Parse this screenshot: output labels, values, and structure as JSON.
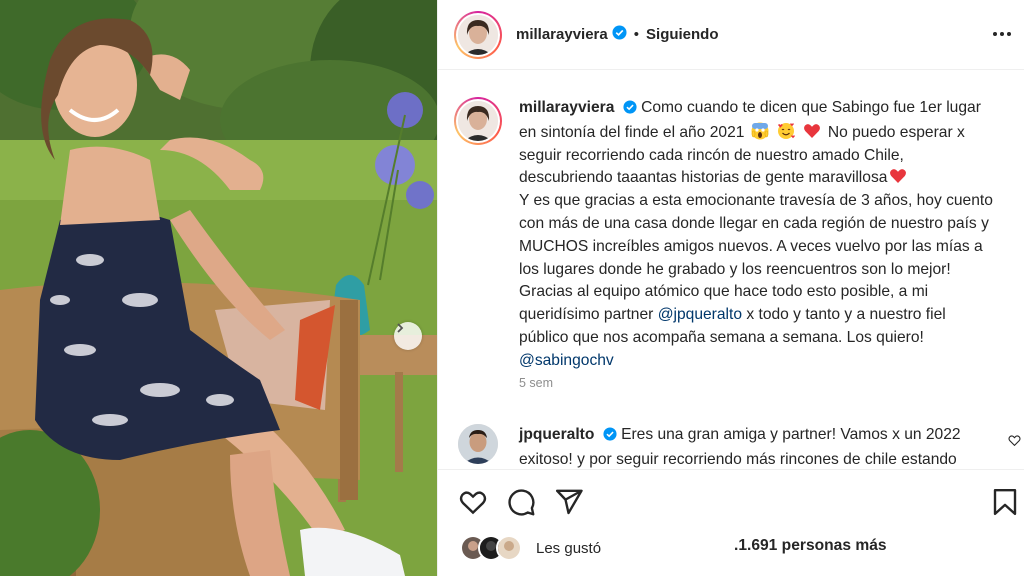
{
  "post": {
    "username": "millarayviera",
    "separator": "•",
    "follow_status": "Siguiendo",
    "caption_lines": [
      "Como cuando te dicen que Sabingo fue 1er lugar",
      "en sintonía del finde el año 2021",
      "No puedo esperar x",
      "seguir recorriendo cada rincón de nuestro amado Chile,",
      "descubriendo taaantas historias de gente maravillosa",
      "Y es que gracias a esta emocionante travesía de 3 años, hoy cuento",
      "con más de una casa donde llegar en cada región de nuestro país y",
      "MUCHOS increíbles amigos nuevos. A veces vuelvo por las mías a",
      "los lugares donde he grabado y los reencuentros son lo mejor!",
      "Gracias al equipo atómico que hace todo esto posible, a mi",
      "queridísimo partner",
      "@jpqueralto",
      "x todo y tanto y a nuestro fiel",
      "público que nos acompaña semana a semana. Los quiero!",
      "@sabingochv"
    ],
    "emojis": [
      "scream-emoji",
      "smiling-hearts-emoji",
      "red-heart-emoji",
      "red-heart-emoji"
    ],
    "age": "5 sem"
  },
  "reply": {
    "username": "jpqueralto",
    "lines": [
      "Eres una gran amiga y partner! Vamos x un 2022",
      "exitoso! y por seguir recorriendo más rincones de chile estando"
    ]
  },
  "likes": {
    "prefix": "Les gustó",
    "count_text": ".1.691 personas más"
  },
  "icons": {
    "heart": "heart-icon",
    "comment": "comment-icon",
    "share": "share-icon",
    "bookmark": "bookmark-icon",
    "more": "more-options-icon",
    "next": "chevron-right-icon",
    "verified": "verified-badge-icon"
  },
  "colors": {
    "text": "#262626",
    "muted": "#8e8e8e",
    "link": "#00376b",
    "verified": "#0095f6",
    "border": "#efefef"
  }
}
